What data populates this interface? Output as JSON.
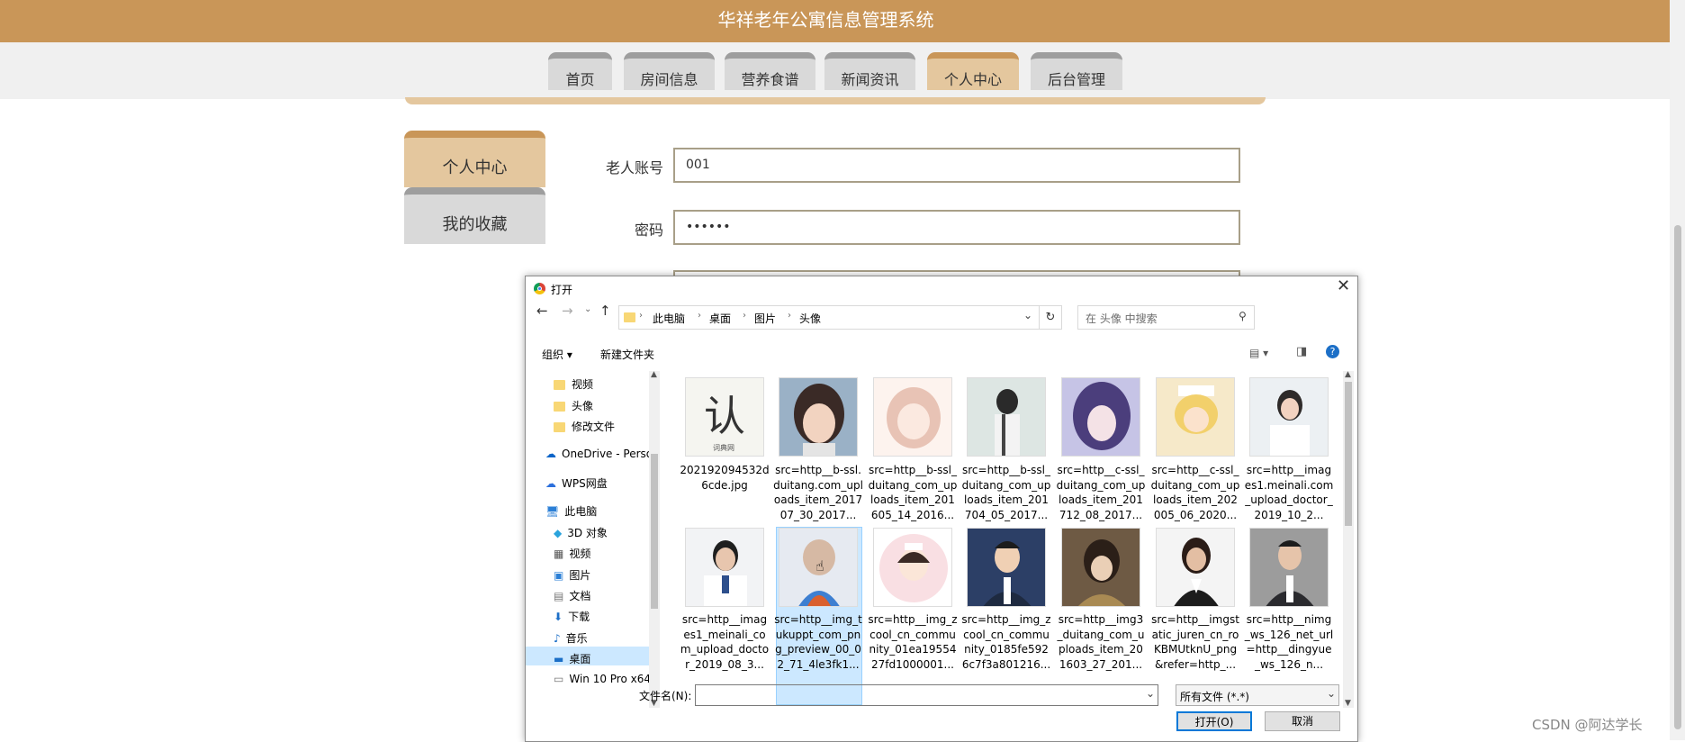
{
  "header": {
    "title": "华祥老年公寓信息管理系统"
  },
  "nav": {
    "tabs": [
      {
        "label": "首页"
      },
      {
        "label": "房间信息"
      },
      {
        "label": "营养食谱"
      },
      {
        "label": "新闻资讯"
      },
      {
        "label": "个人中心"
      },
      {
        "label": "后台管理"
      }
    ],
    "active": "个人中心"
  },
  "side": {
    "tabs": [
      {
        "label": "个人中心"
      },
      {
        "label": "我的收藏"
      }
    ]
  },
  "form": {
    "account_label": "老人账号",
    "account_value": "001",
    "password_label": "密码",
    "password_value": "••••••"
  },
  "dialog": {
    "title": "打开",
    "breadcrumb": [
      "此电脑",
      "桌面",
      "图片",
      "头像"
    ],
    "search_placeholder": "在 头像 中搜索",
    "organize_label": "组织 ▾",
    "new_folder_label": "新建文件夹",
    "tree": [
      {
        "label": "视频",
        "icon": "folder-icon"
      },
      {
        "label": "头像",
        "icon": "folder-icon"
      },
      {
        "label": "修改文件",
        "icon": "folder-icon"
      },
      {
        "label": "OneDrive - Perso",
        "icon": "cloud-icon"
      },
      {
        "label": "WPS网盘",
        "icon": "cloud-icon"
      },
      {
        "label": "此电脑",
        "icon": "computer-icon"
      },
      {
        "label": "3D 对象",
        "icon": "cube-icon"
      },
      {
        "label": "视频",
        "icon": "video-icon"
      },
      {
        "label": "图片",
        "icon": "picture-icon"
      },
      {
        "label": "文档",
        "icon": "document-icon"
      },
      {
        "label": "下载",
        "icon": "download-icon"
      },
      {
        "label": "音乐",
        "icon": "music-icon"
      },
      {
        "label": "桌面",
        "icon": "desktop-icon"
      },
      {
        "label": "Win 10 Pro x64",
        "icon": "drive-icon"
      }
    ],
    "files_row1": [
      "202192094532d6cde.jpg",
      "src=http__b-ssl.duitang.com_uploads_item_201707_30_2017...",
      "src=http__b-ssl_duitang_com_uploads_item_201605_14_2016...",
      "src=http__b-ssl_duitang_com_uploads_item_201704_05_2017...",
      "src=http__c-ssl_duitang_com_uploads_item_201712_08_2017...",
      "src=http__c-ssl_duitang_com_uploads_item_202005_06_2020...",
      "src=http__images1.meinali.com_upload_doctor_2019_10_2..."
    ],
    "files_row2": [
      "src=http__images1_meinali_com_upload_doctor_2019_08_3...",
      "src=http__img_tukuppt_com_png_preview_00_02_71_4le3fk1...",
      "src=http__img_zcool_cn_community_01ea1955427fd1000001...",
      "src=http__img_zcool_cn_community_0185fe5926c7f3a801216...",
      "src=http__img3_duitang_com_uploads_item_201603_27_201...",
      "src=http__imgstatic_juren_cn_roKBMUtknU_png&refer=http_...",
      "src=http__nimg_ws_126_net_url=http__dingyue_ws_126_n..."
    ],
    "filename_label": "文件名(N):",
    "filename_value": "",
    "filter_value": "所有文件 (*.*)",
    "open_label": "打开(O)",
    "cancel_label": "取消"
  },
  "watermark": "CSDN @阿达学长",
  "colors": {
    "brand": "#c99658",
    "tab_active": "#e4c79e",
    "tab_inactive": "#d9d9d9"
  }
}
